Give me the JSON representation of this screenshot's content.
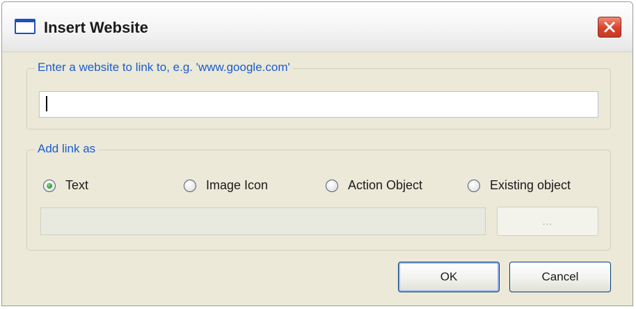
{
  "window": {
    "title": "Insert Website",
    "icon": "window-icon",
    "close_icon": "close-icon"
  },
  "website_group": {
    "label": "Enter a website to link to, e.g. 'www.google.com'",
    "input_value": "",
    "input_placeholder": ""
  },
  "link_group": {
    "label": "Add link as",
    "options": [
      {
        "label": "Text",
        "checked": true
      },
      {
        "label": "Image Icon",
        "checked": false
      },
      {
        "label": "Action Object",
        "checked": false
      },
      {
        "label": "Existing object",
        "checked": false
      }
    ],
    "browse_label": "..."
  },
  "buttons": {
    "ok": "OK",
    "cancel": "Cancel"
  },
  "colors": {
    "group_label": "#1a5ccf",
    "close_button": "#d6422b",
    "radio_selected": "#2f9a2f"
  }
}
